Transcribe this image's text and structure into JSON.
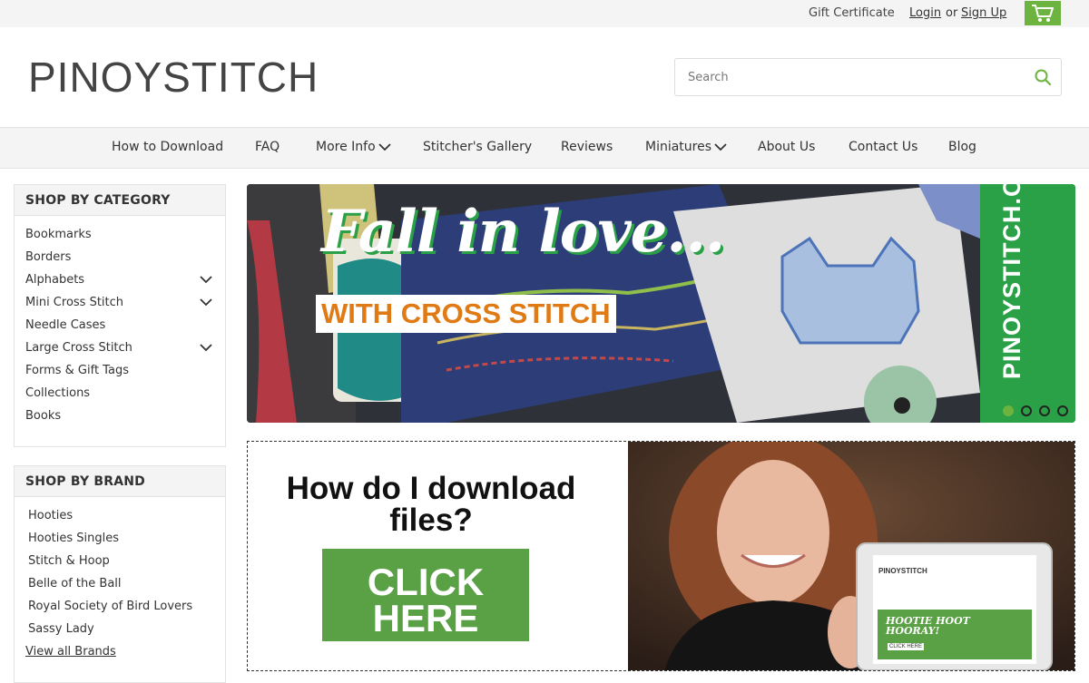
{
  "topbar": {
    "gift_certificate": "Gift Certificate",
    "login": "Login",
    "or": "or",
    "signup": "Sign Up",
    "cart_icon": "cart-icon"
  },
  "header": {
    "logo": "PINOYSTITCH",
    "search_placeholder": "Search",
    "search_icon": "search-icon"
  },
  "nav": {
    "items": [
      {
        "label": "How to Download"
      },
      {
        "label": "FAQ"
      },
      {
        "label": "More Info",
        "dropdown": true
      },
      {
        "label": "Stitcher's Gallery"
      },
      {
        "label": "Reviews"
      },
      {
        "label": "Miniatures",
        "dropdown": true
      },
      {
        "label": "About Us"
      },
      {
        "label": "Contact Us"
      },
      {
        "label": "Blog"
      }
    ]
  },
  "sidebar": {
    "category": {
      "title": "SHOP BY CATEGORY",
      "items": [
        {
          "label": "Bookmarks"
        },
        {
          "label": "Borders"
        },
        {
          "label": "Alphabets",
          "expandable": true
        },
        {
          "label": "Mini Cross Stitch",
          "expandable": true
        },
        {
          "label": "Needle Cases"
        },
        {
          "label": "Large Cross Stitch",
          "expandable": true
        },
        {
          "label": "Forms & Gift Tags"
        },
        {
          "label": "Collections"
        },
        {
          "label": "Books"
        }
      ]
    },
    "brand": {
      "title": "SHOP BY BRAND",
      "items": [
        {
          "label": "Hooties"
        },
        {
          "label": "Hooties Singles"
        },
        {
          "label": "Stitch & Hoop"
        },
        {
          "label": "Belle of the Ball"
        },
        {
          "label": "Royal Society of Bird Lovers"
        },
        {
          "label": "Sassy Lady"
        }
      ],
      "view_all": "View all Brands"
    }
  },
  "hero": {
    "headline": "Fall in love...",
    "subline": "WITH CROSS STITCH",
    "side_text": "PINOYSTITCH.ORG",
    "slides": 4,
    "active_slide": 1
  },
  "promo": {
    "question": "How do I download files?",
    "cta_line1": "CLICK",
    "cta_line2": "HERE",
    "tablet_logo": "PINOYSTITCH",
    "tablet_banner": "HOOTIE HOOT HOORAY!",
    "tablet_button": "CLICK HERE"
  },
  "colors": {
    "accent_green": "#6db33f",
    "banner_green": "#2aa047",
    "cta_green": "#5aa045",
    "orange": "#e07a14"
  }
}
